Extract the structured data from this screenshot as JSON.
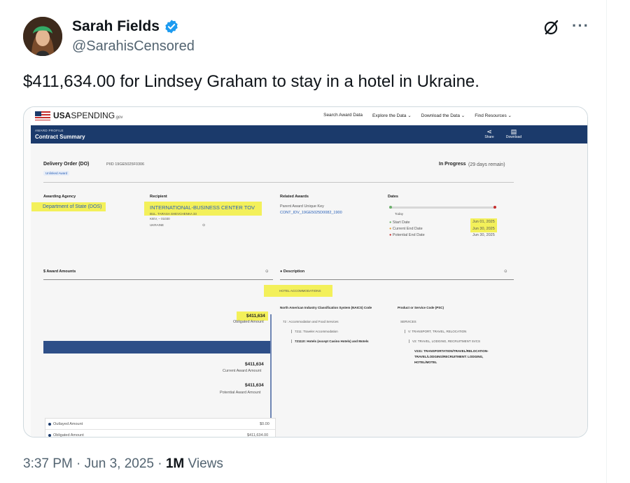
{
  "author": {
    "display_name": "Sarah Fields",
    "handle": "@SarahisCensored",
    "verified": true
  },
  "tweet": {
    "text": "$411,634.00 for Lindsey Graham to stay in a hotel in Ukraine.",
    "time": "3:37 PM",
    "date": "Jun 3, 2025",
    "views_count": "1M",
    "views_label": "Views",
    "separator": "·"
  },
  "actions": {
    "more": "···"
  },
  "embedded": {
    "brand_bold": "USA",
    "brand_rest": "SPENDING",
    "brand_suffix": ".gov",
    "nav": [
      "Search Award Data",
      "Explore the Data ⌄",
      "Download the Data ⌄",
      "Find Resources ⌄"
    ],
    "band_kicker": "AWARD PROFILE",
    "band_title": "Contract Summary",
    "share_label": "Share",
    "download_label": "Download",
    "order_title": "Delivery Order (DO)",
    "piid": "PIID  19GE5025F0306",
    "chip": "Unlinked Award",
    "status": "In Progress",
    "status_note": "(29 days remain)",
    "awarding_agency_label": "Awarding Agency",
    "awarding_agency": "Department of State (DOS)",
    "recipient_label": "Recipient",
    "recipient": "INTERNATIONAL-BUSINESS CENTER TOV",
    "recipient_addr1": "BUL. TARASA SHEVCHENKA 33",
    "recipient_addr2": "KIEV, – 01030",
    "recipient_addr3": "UKRAINE",
    "related_label": "Related Awards",
    "parent_key_label": "Parent Award Unique Key",
    "parent_key": "CONT_IDV_19GE5025D0082_1900",
    "dates_label": "Dates",
    "today": "Today",
    "start_label": "Start Date",
    "current_end_label": "Current End Date",
    "potential_end_label": "Potential End Date",
    "start_date": "Jun 01, 2025",
    "current_end_date": "Jun 30, 2025",
    "potential_end_date": "Jun 30, 2025",
    "amounts_label": "$ Award Amounts",
    "obligated_value": "$411,634",
    "obligated_label": "Obligated Amount",
    "current_value": "$411,634",
    "current_label": "Current Award Amount",
    "potential_value": "$411,634",
    "potential_label": "Potential Award Amount",
    "outlayed_label": "Outlayed Amount",
    "outlayed_value": "$0.00",
    "obligated2_label": "Obligated Amount",
    "obligated2_value": "$411,634.00",
    "description_label": "Description",
    "description": "HOTEL ACCOMMODATIONS",
    "naics_label": "North American Industry Classification System (NAICS) Code",
    "naics_1": "72 : Accommodation and Food Services",
    "naics_2": "7211: Traveler Accommodation",
    "naics_3": "721110: Hotels (except Casino Hotels) and Motels",
    "psc_label": "Product or Service Code (PSC)",
    "psc_1": "SERVICES",
    "psc_2": "V: TRANSPORT, TRAVEL, RELOCATION",
    "psc_3": "V2: TRAVEL, LODGING, RECRUITMENT SVCS",
    "psc_4a": "V231: TRANSPORTATION/TRAVEL/RELOCATION-",
    "psc_4b": "TRAVEL/LODGING/RECRUITMENT: LODGING,",
    "psc_4c": "HOTEL/MOTEL"
  }
}
